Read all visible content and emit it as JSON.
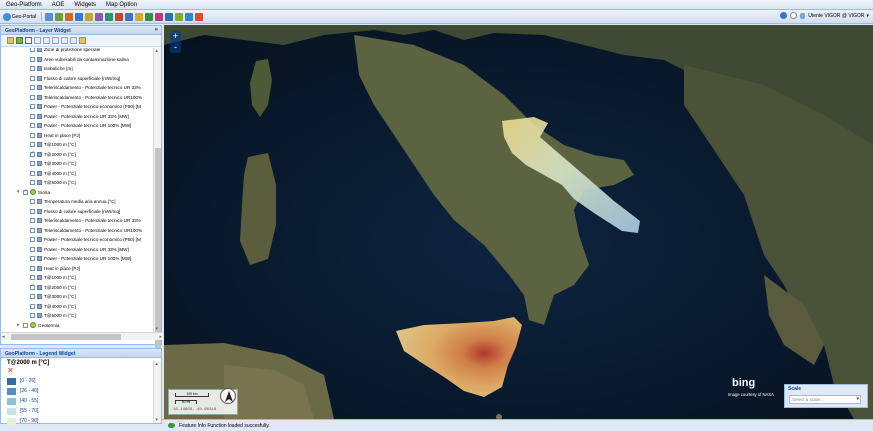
{
  "menu": [
    "Geo-Platform",
    "AOE",
    "Widgets",
    "Map Option"
  ],
  "toolbar": {
    "portal_label": "Geo-Portal",
    "user_label": "Utente VIGOR @ VIGOR",
    "icon_colors": [
      "#5b8fd1",
      "#6f9f3c",
      "#d06a2a",
      "#3a7bc8",
      "#c9a227",
      "#8a5bb5",
      "#2f8f6f",
      "#c4472c",
      "#4a73b7",
      "#d7a73a",
      "#3c8d3c",
      "#b33c7a",
      "#2f6fb0",
      "#7fae2f",
      "#2c8fbe",
      "#d94d2b"
    ]
  },
  "layer_panel": {
    "title": "GeoPlatform - Layer Widget",
    "rows": [
      {
        "label": "Zone di protezione speciale",
        "checked": false,
        "level": 2,
        "kind": "layer"
      },
      {
        "label": "Aree vulnerabili da contaminazione salina",
        "checked": false,
        "level": 2,
        "kind": "layer"
      },
      {
        "label": "Isobatiche [m]",
        "checked": false,
        "level": 2,
        "kind": "layer"
      },
      {
        "label": "Flusso di calore superficiale [mW/mq]",
        "checked": false,
        "level": 2,
        "kind": "layer"
      },
      {
        "label": "Teleriscaldamento - Potenziale tecnico UR 33%",
        "checked": false,
        "level": 2,
        "kind": "layer"
      },
      {
        "label": "Teleriscaldamento - Potenziale tecnico UR100%",
        "checked": false,
        "level": 2,
        "kind": "layer"
      },
      {
        "label": "Power - Potenziale tecnico economico (P50) [M",
        "checked": false,
        "level": 2,
        "kind": "layer"
      },
      {
        "label": "Power - Potenziale tecnico UR 33% [MW]",
        "checked": false,
        "level": 2,
        "kind": "layer"
      },
      {
        "label": "Power - Potenziale tecnico UR 100% [MW]",
        "checked": false,
        "level": 2,
        "kind": "layer"
      },
      {
        "label": "Heat in place [PJ]",
        "checked": false,
        "level": 2,
        "kind": "layer"
      },
      {
        "label": "T@1000 m [°C]",
        "checked": false,
        "level": 2,
        "kind": "layer"
      },
      {
        "label": "T@2000 m [°C]",
        "checked": true,
        "level": 2,
        "kind": "layer"
      },
      {
        "label": "T@3000 m [°C]",
        "checked": false,
        "level": 2,
        "kind": "layer"
      },
      {
        "label": "T@4000 m [°C]",
        "checked": false,
        "level": 2,
        "kind": "layer"
      },
      {
        "label": "T@5000 m [°C]",
        "checked": false,
        "level": 2,
        "kind": "layer"
      },
      {
        "label": "Sicilia",
        "checked": true,
        "level": 1,
        "kind": "group",
        "expanded": true
      },
      {
        "label": "Temperatura media aria annua [°C]",
        "checked": false,
        "level": 2,
        "kind": "layer"
      },
      {
        "label": "Flusso di calore superficiale [mW/mq]",
        "checked": false,
        "level": 2,
        "kind": "layer"
      },
      {
        "label": "Teleriscaldamento - Potenziale tecnico UR 33%",
        "checked": false,
        "level": 2,
        "kind": "layer"
      },
      {
        "label": "Teleriscaldamento - Potenziale tecnico UR100%",
        "checked": false,
        "level": 2,
        "kind": "layer"
      },
      {
        "label": "Power - Potenziale tecnico economico (P50) [M",
        "checked": false,
        "level": 2,
        "kind": "layer"
      },
      {
        "label": "Power - Potenziale tecnico UR 33% [MW]",
        "checked": false,
        "level": 2,
        "kind": "layer"
      },
      {
        "label": "Power - Potenziale tecnico UR 100% [MW]",
        "checked": false,
        "level": 2,
        "kind": "layer"
      },
      {
        "label": "Heat in place [PJ]",
        "checked": false,
        "level": 2,
        "kind": "layer"
      },
      {
        "label": "T@1000 m [°C]",
        "checked": false,
        "level": 2,
        "kind": "layer"
      },
      {
        "label": "T@2000 m [°C]",
        "checked": true,
        "level": 2,
        "kind": "layer"
      },
      {
        "label": "T@3000 m [°C]",
        "checked": false,
        "level": 2,
        "kind": "layer"
      },
      {
        "label": "T@4000 m [°C]",
        "checked": false,
        "level": 2,
        "kind": "layer"
      },
      {
        "label": "T@5000 m [°C]",
        "checked": false,
        "level": 2,
        "kind": "layer"
      },
      {
        "label": "Geotermia",
        "checked": false,
        "level": 1,
        "kind": "group",
        "expanded": false
      }
    ]
  },
  "legend_panel": {
    "title": "GeoPlatform - Legend Widget",
    "layer_title": "T@2000 m [°C]",
    "items": [
      {
        "label": "[0 - 26]",
        "color": "#2c6ea6"
      },
      {
        "label": "[26 - 40]",
        "color": "#4a92c4"
      },
      {
        "label": "[40 - 55]",
        "color": "#8cc0df"
      },
      {
        "label": "[55 - 70]",
        "color": "#c8e3ec"
      },
      {
        "label": "[70 - 90]",
        "color": "#e4f0d8"
      }
    ]
  },
  "map": {
    "zoom_in": "+",
    "zoom_out": "-",
    "scale_km": "100 km",
    "scale_mi": "50 mi",
    "coords": "16.14609, 40.90319",
    "bing_logo": "bing",
    "bing_credit": "Image courtesy of NASA",
    "scale_panel_title": "Scale",
    "scale_placeholder": "Select a scale..."
  },
  "status": {
    "message": "Feature Info Function loaded succesfully."
  }
}
